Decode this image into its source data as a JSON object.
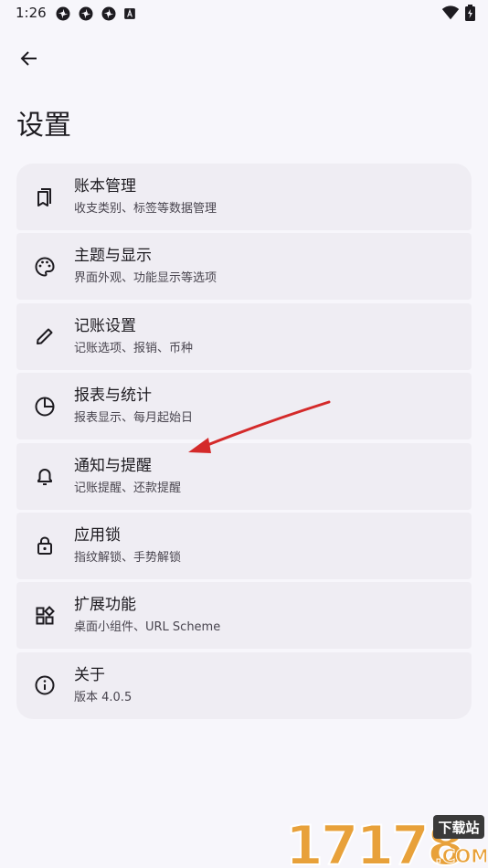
{
  "status_bar": {
    "time": "1:26",
    "notification_icons": [
      "pinwheel-icon",
      "pinwheel-icon",
      "pinwheel-icon",
      "a-badge-icon"
    ],
    "right_icons": [
      "wifi-icon",
      "battery-icon"
    ]
  },
  "header": {
    "back_icon": "arrow-left-icon",
    "title": "设置"
  },
  "settings": {
    "items": [
      {
        "icon": "book-icon",
        "title": "账本管理",
        "subtitle": "收支类别、标签等数据管理"
      },
      {
        "icon": "palette-icon",
        "title": "主题与显示",
        "subtitle": "界面外观、功能显示等选项"
      },
      {
        "icon": "pencil-icon",
        "title": "记账设置",
        "subtitle": "记账选项、报销、币种"
      },
      {
        "icon": "pie-chart-icon",
        "title": "报表与统计",
        "subtitle": "报表显示、每月起始日"
      },
      {
        "icon": "bell-icon",
        "title": "通知与提醒",
        "subtitle": "记账提醒、还款提醒"
      },
      {
        "icon": "lock-icon",
        "title": "应用锁",
        "subtitle": "指纹解锁、手势解锁"
      },
      {
        "icon": "widgets-icon",
        "title": "扩展功能",
        "subtitle": "桌面小组件、URL Scheme"
      },
      {
        "icon": "info-icon",
        "title": "关于",
        "subtitle": "版本 4.0.5"
      }
    ]
  },
  "annotation": {
    "color": "#d42a2a",
    "points_to": "通知与提醒"
  },
  "watermark": {
    "text": "17178",
    "badge": "下载站",
    "suffix": ".COM"
  },
  "colors": {
    "background": "#f7f6fb",
    "card": "#efedf3",
    "text": "#1d1b20",
    "subtext": "#49454f"
  }
}
